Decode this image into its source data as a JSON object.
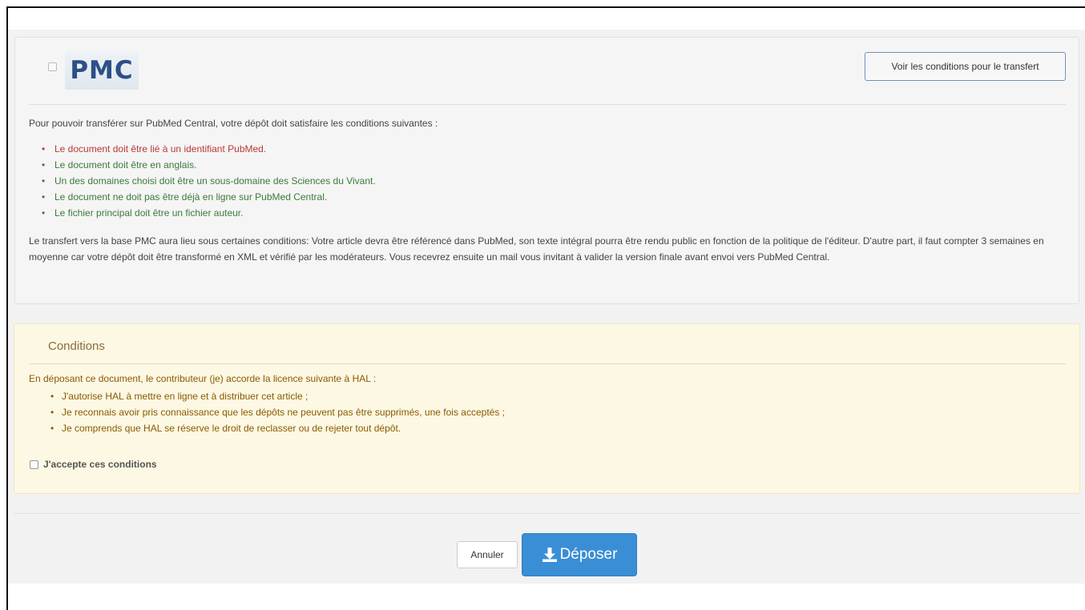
{
  "pmc": {
    "logo_text": "PMC",
    "transfer_button": "Voir les conditions pour le transfert",
    "intro": "Pour pouvoir transférer sur PubMed Central, votre dépôt doit satisfaire les conditions suivantes :",
    "conditions": [
      {
        "text": "Le document doit être lié à un identifiant PubMed.",
        "status": "unmet"
      },
      {
        "text": "Le document doit être en anglais.",
        "status": "met"
      },
      {
        "text": "Un des domaines choisi doit être un sous-domaine des Sciences du Vivant.",
        "status": "met"
      },
      {
        "text": "Le document ne doit pas être déjà en ligne sur PubMed Central.",
        "status": "met"
      },
      {
        "text": "Le fichier principal doit être un fichier auteur.",
        "status": "met"
      }
    ],
    "details": "Le transfert vers la base PMC aura lieu sous certaines conditions: Votre article devra être référencé dans PubMed, son texte intégral pourra être rendu public en fonction de la politique de l'éditeur. D'autre part, il faut compter 3 semaines en moyenne car votre dépôt doit être transformé en XML et vérifié par les modérateurs. Vous recevrez ensuite un mail vous invitant à valider la version finale avant envoi vers PubMed Central.",
    "checkbox_checked": false
  },
  "conditions_panel": {
    "title": "Conditions",
    "intro": "En déposant ce document, le contributeur (je) accorde la licence suivante à HAL :",
    "items": [
      "J'autorise HAL à mettre en ligne et à distribuer cet article ;",
      "Je reconnais avoir pris connaissance que les dépôts ne peuvent pas être supprimés, une fois acceptés ;",
      "Je comprends que HAL se réserve le droit de reclasser ou de rejeter tout dépôt."
    ],
    "accept_label": "J'accepte ces conditions",
    "accept_checked": false
  },
  "footer": {
    "cancel_label": "Annuler",
    "submit_label": "Déposer",
    "submit_icon": "download-icon"
  },
  "colors": {
    "unmet": "#b73a36",
    "met": "#3c7a3c",
    "primary": "#3a8ed5",
    "warning_text": "#8a5a00"
  }
}
